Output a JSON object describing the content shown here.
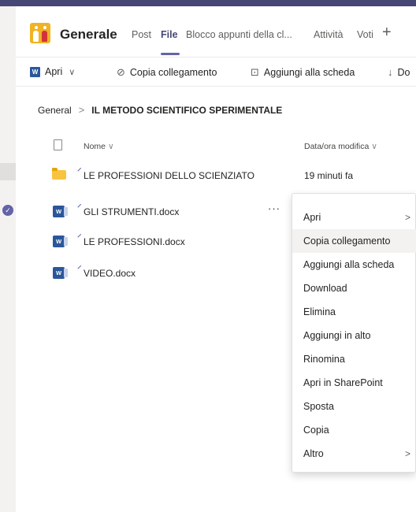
{
  "header": {
    "channel_name": "Generale",
    "tabs": [
      {
        "label": "Post"
      },
      {
        "label": "File"
      },
      {
        "label": "Blocco appunti della cl..."
      },
      {
        "label": "Attività"
      },
      {
        "label": "Voti"
      }
    ],
    "add_tab_icon": "plus-icon"
  },
  "toolbar": {
    "open_label": "Apri",
    "copy_link_label": "Copia collegamento",
    "add_to_tab_label": "Aggiungi alla scheda",
    "download_label": "Do"
  },
  "breadcrumb": {
    "root": "General",
    "current": "IL METODO SCIENTIFICO SPERIMENTALE"
  },
  "file_list": {
    "columns": {
      "name": "Nome",
      "modified": "Data/ora modifica"
    },
    "rows": [
      {
        "type": "folder",
        "name": "LE PROFESSIONI DELLO SCIENZIATO",
        "modified": "19 minuti fa"
      },
      {
        "type": "docx",
        "name": "GLI STRUMENTI.docx",
        "modified": "",
        "selected": true
      },
      {
        "type": "docx",
        "name": "LE PROFESSIONI.docx",
        "modified": ""
      },
      {
        "type": "docx",
        "name": "VIDEO.docx",
        "modified": ""
      }
    ],
    "more_options": "···"
  },
  "context_menu": {
    "items": [
      {
        "label": "Apri",
        "submenu": true
      },
      {
        "label": "Copia collegamento",
        "highlighted": true
      },
      {
        "label": "Aggiungi alla scheda"
      },
      {
        "label": "Download"
      },
      {
        "label": "Elimina"
      },
      {
        "label": "Aggiungi in alto"
      },
      {
        "label": "Rinomina"
      },
      {
        "label": "Apri in SharePoint"
      },
      {
        "label": "Sposta"
      },
      {
        "label": "Copia"
      },
      {
        "label": "Altro",
        "submenu": true
      }
    ]
  },
  "colors": {
    "accent": "#6264a7",
    "top_bar": "#464775",
    "folder": "#f8c440",
    "word": "#2b579a"
  }
}
